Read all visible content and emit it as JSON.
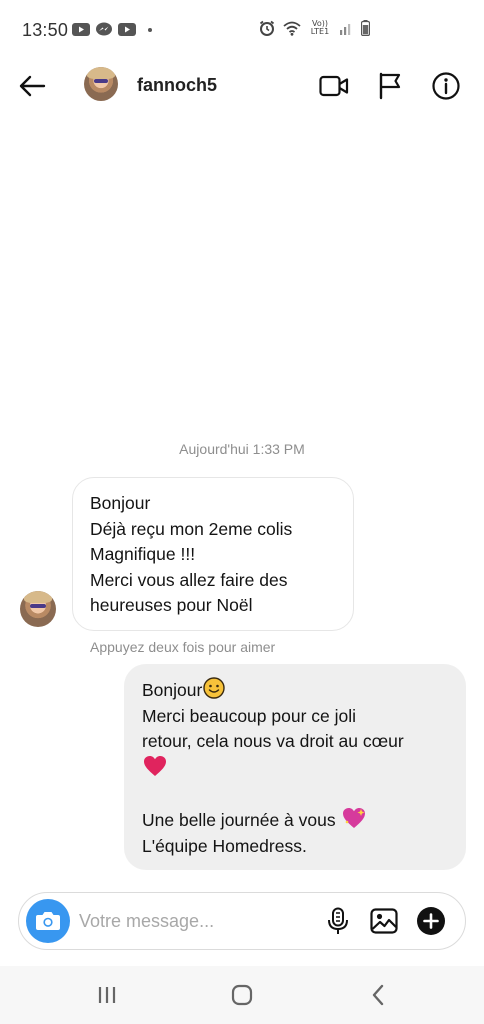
{
  "status_bar": {
    "time": "13:50",
    "network_label": "Vo)) LTE1"
  },
  "header": {
    "username": "fannoch5"
  },
  "chat": {
    "timestamp": "Aujourd'hui 1:33 PM",
    "incoming": {
      "lines": [
        "Bonjour",
        "Déjà reçu mon 2eme colis",
        "Magnifique !!!",
        "Merci vous allez faire des",
        "heureuses pour Noël"
      ],
      "hint": "Appuyez deux fois pour aimer"
    },
    "outgoing": {
      "lines": [
        "Bonjour",
        "Merci beaucoup pour ce joli",
        "retour, cela nous va droit au cœur",
        "",
        "",
        "Une belle journée à vous",
        "L'équipe Homedress."
      ],
      "emojis": [
        "slightly-smiling-face-emoji",
        "red-heart-emoji",
        "sparkling-heart-emoji"
      ]
    }
  },
  "composer": {
    "placeholder": "Votre message..."
  },
  "colors": {
    "accent": "#3897f0",
    "outgoing_bubble": "#efefef",
    "heart": "#e0245e"
  }
}
